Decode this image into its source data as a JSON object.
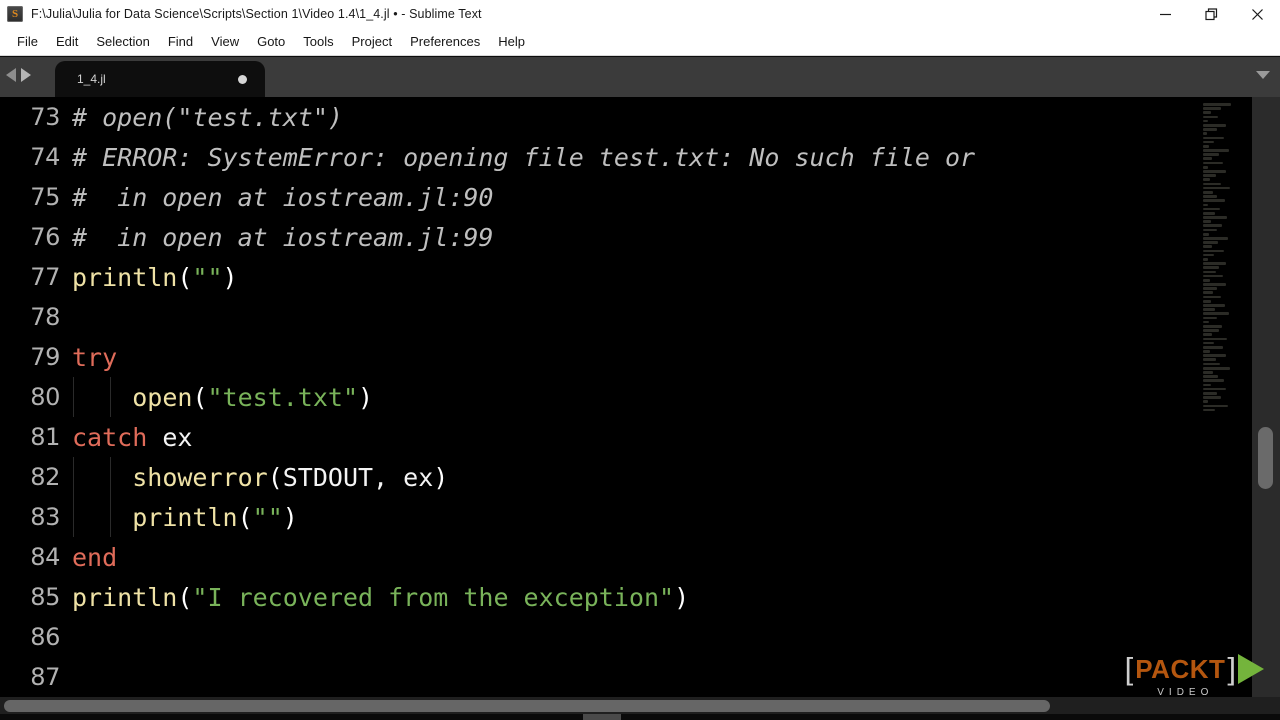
{
  "window": {
    "title": "F:\\Julia\\Julia for Data Science\\Scripts\\Section 1\\Video 1.4\\1_4.jl • - Sublime Text",
    "app_icon": "sublime-text-icon",
    "controls": [
      {
        "name": "minimize",
        "glyph": "—"
      },
      {
        "name": "restore",
        "glyph": "❐"
      },
      {
        "name": "close",
        "glyph": "✕"
      }
    ]
  },
  "menubar": {
    "items": [
      {
        "label": "File"
      },
      {
        "label": "Edit"
      },
      {
        "label": "Selection"
      },
      {
        "label": "Find"
      },
      {
        "label": "View"
      },
      {
        "label": "Goto"
      },
      {
        "label": "Tools"
      },
      {
        "label": "Project"
      },
      {
        "label": "Preferences"
      },
      {
        "label": "Help"
      }
    ]
  },
  "tabbar": {
    "prev_icon": "chevron-left-icon",
    "next_icon": "chevron-right-icon",
    "overflow_icon": "chevron-down-icon",
    "tabs": [
      {
        "label": "1_4.jl",
        "modified": true,
        "active": true
      }
    ]
  },
  "editor": {
    "language": "julia",
    "first_visible_line": 73,
    "last_visible_line": 87,
    "colors": {
      "background": "#000000",
      "line_number": "#b2b2b2",
      "comment": "#bfbfbf",
      "function": "#efe2a6",
      "string": "#79b35a",
      "keyword": "#e06c5a",
      "plain": "#f4f4f4"
    },
    "lines": [
      {
        "number": "73",
        "indent": 0,
        "tokens": [
          {
            "t": "# open(\"test.txt\")",
            "c": "comment"
          }
        ]
      },
      {
        "number": "74",
        "indent": 0,
        "tokens": [
          {
            "t": "# ERROR: SystemError: opening file test.txt: No such file or",
            "c": "comment"
          }
        ]
      },
      {
        "number": "75",
        "indent": 0,
        "tokens": [
          {
            "t": "#  in open at iostream.jl:90",
            "c": "comment"
          }
        ]
      },
      {
        "number": "76",
        "indent": 0,
        "tokens": [
          {
            "t": "#  in open at iostream.jl:99",
            "c": "comment"
          }
        ]
      },
      {
        "number": "77",
        "indent": 0,
        "tokens": [
          {
            "t": "println",
            "c": "func"
          },
          {
            "t": "(",
            "c": "punc"
          },
          {
            "t": "\"\"",
            "c": "string"
          },
          {
            "t": ")",
            "c": "punc"
          }
        ]
      },
      {
        "number": "78",
        "indent": 0,
        "tokens": []
      },
      {
        "number": "79",
        "indent": 0,
        "tokens": [
          {
            "t": "try",
            "c": "kw"
          }
        ]
      },
      {
        "number": "80",
        "indent": 2,
        "tokens": [
          {
            "t": "    ",
            "c": "plain"
          },
          {
            "t": "open",
            "c": "func"
          },
          {
            "t": "(",
            "c": "punc"
          },
          {
            "t": "\"test.txt\"",
            "c": "string"
          },
          {
            "t": ")",
            "c": "punc"
          }
        ]
      },
      {
        "number": "81",
        "indent": 0,
        "tokens": [
          {
            "t": "catch",
            "c": "kw"
          },
          {
            "t": " ex",
            "c": "plain"
          }
        ]
      },
      {
        "number": "82",
        "indent": 2,
        "tokens": [
          {
            "t": "    ",
            "c": "plain"
          },
          {
            "t": "showerror",
            "c": "func"
          },
          {
            "t": "(",
            "c": "punc"
          },
          {
            "t": "STDOUT, ex",
            "c": "plain"
          },
          {
            "t": ")",
            "c": "punc"
          }
        ]
      },
      {
        "number": "83",
        "indent": 2,
        "tokens": [
          {
            "t": "    ",
            "c": "plain"
          },
          {
            "t": "println",
            "c": "func"
          },
          {
            "t": "(",
            "c": "punc"
          },
          {
            "t": "\"\"",
            "c": "string"
          },
          {
            "t": ")",
            "c": "punc"
          }
        ]
      },
      {
        "number": "84",
        "indent": 0,
        "tokens": [
          {
            "t": "end",
            "c": "kw"
          }
        ]
      },
      {
        "number": "85",
        "indent": 0,
        "tokens": [
          {
            "t": "println",
            "c": "func"
          },
          {
            "t": "(",
            "c": "punc"
          },
          {
            "t": "\"I recovered from the exception\"",
            "c": "string"
          },
          {
            "t": ")",
            "c": "punc"
          }
        ]
      },
      {
        "number": "86",
        "indent": 0,
        "tokens": []
      },
      {
        "number": "87",
        "indent": 0,
        "tokens": []
      }
    ]
  },
  "minimap": {
    "name": "code-minimap",
    "rows": [
      62,
      40,
      18,
      34,
      10,
      52,
      30,
      8,
      46,
      24,
      14,
      58,
      36,
      20,
      44,
      12,
      50,
      28,
      16,
      40,
      60,
      22,
      32,
      48,
      10,
      38,
      26,
      54,
      18,
      42,
      30,
      14,
      56,
      34,
      20,
      46,
      24,
      12,
      50,
      36,
      28,
      44,
      16,
      52,
      32,
      22,
      40,
      18,
      48,
      26,
      58,
      30,
      14,
      42,
      36,
      20,
      54,
      24,
      44,
      16,
      50,
      28,
      38,
      60,
      22,
      34,
      46,
      18,
      52,
      30,
      40,
      12,
      56,
      26
    ]
  },
  "scrollbars": {
    "vertical": {
      "name": "vertical-scrollbar"
    },
    "horizontal": {
      "name": "horizontal-scrollbar"
    }
  },
  "branding": {
    "bracket_left": "[",
    "bracket_right": "]",
    "name": "PACKT",
    "subtitle": "VIDEO",
    "play_icon": "play-triangle-icon",
    "name_color": "#b4560f",
    "play_color": "#74b43c"
  }
}
